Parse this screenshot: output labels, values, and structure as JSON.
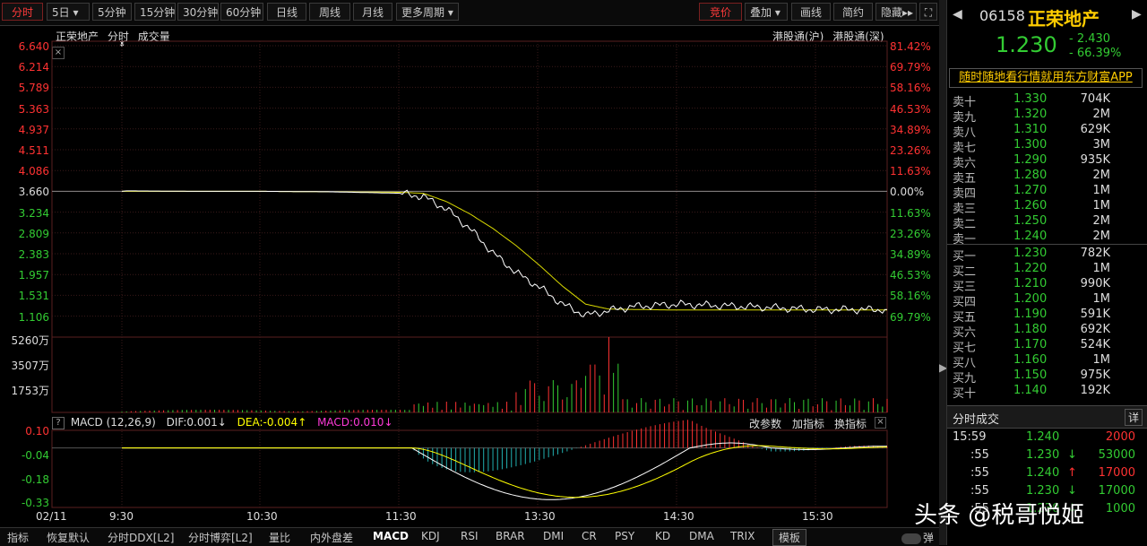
{
  "toolbar": {
    "tabs": [
      "分时",
      "5日",
      "5分钟",
      "15分钟",
      "30分钟",
      "60分钟",
      "日线",
      "周线",
      "月线",
      "更多周期"
    ],
    "right_buttons": [
      "竞价",
      "叠加",
      "画线",
      "简约",
      "隐藏"
    ]
  },
  "chart_header": {
    "name": "正荣地产",
    "mode": "分时",
    "volume_label": "成交量",
    "right_a": "港股通(沪)",
    "right_b": "港股通(深)"
  },
  "macd_header": {
    "label": "MACD (12,26,9)",
    "dif": "DIF:0.001↓",
    "dea": "DEA:-0.004↑",
    "macd": "MACD:0.010↓",
    "btn1": "改参数",
    "btn2": "加指标",
    "btn3": "换指标"
  },
  "colors": {
    "up": "#ff3232",
    "down": "#33cc33",
    "price_line": "#ffffff",
    "avg_line": "#d8d800",
    "grid": "#3a1a1a"
  },
  "chart_data": {
    "type": "line",
    "price_axis_left": [
      "6.640",
      "6.214",
      "5.789",
      "5.363",
      "4.937",
      "4.511",
      "4.086",
      "3.660",
      "3.234",
      "2.809",
      "2.383",
      "1.957",
      "1.531",
      "1.106"
    ],
    "pct_axis_right": [
      "81.42%",
      "69.79%",
      "58.16%",
      "46.53%",
      "34.89%",
      "23.26%",
      "11.63%",
      "0.00%",
      "11.63%",
      "23.26%",
      "34.89%",
      "46.53%",
      "58.16%",
      "69.79%"
    ],
    "volume_axis": [
      "5260万",
      "3507万",
      "1753万"
    ],
    "macd_axis": [
      "0.10",
      "-0.04",
      "-0.18",
      "-0.33"
    ],
    "time_labels": [
      "02/11",
      "9:30",
      "10:30",
      "11:30",
      "13:30",
      "14:30",
      "15:30"
    ],
    "price_series": [
      [
        0,
        3.66
      ],
      [
        2,
        3.67
      ],
      [
        30,
        3.66
      ],
      [
        60,
        3.66
      ],
      [
        90,
        3.65
      ],
      [
        120,
        3.62
      ],
      [
        130,
        3.55
      ],
      [
        140,
        3.3
      ],
      [
        150,
        2.9
      ],
      [
        160,
        2.4
      ],
      [
        170,
        2.0
      ],
      [
        180,
        1.7
      ],
      [
        190,
        1.35
      ],
      [
        200,
        1.12
      ],
      [
        210,
        1.22
      ],
      [
        220,
        1.3
      ],
      [
        240,
        1.35
      ],
      [
        270,
        1.3
      ],
      [
        300,
        1.24
      ],
      [
        330,
        1.24
      ]
    ],
    "avg_series": [
      [
        0,
        3.66
      ],
      [
        60,
        3.66
      ],
      [
        120,
        3.64
      ],
      [
        130,
        3.62
      ],
      [
        140,
        3.45
      ],
      [
        150,
        3.2
      ],
      [
        160,
        2.9
      ],
      [
        170,
        2.55
      ],
      [
        180,
        2.15
      ],
      [
        190,
        1.72
      ],
      [
        200,
        1.35
      ],
      [
        210,
        1.25
      ],
      [
        240,
        1.23
      ],
      [
        270,
        1.23
      ],
      [
        300,
        1.23
      ],
      [
        330,
        1.23
      ]
    ],
    "price_range": [
      1.106,
      6.64
    ],
    "macd_range": [
      -0.33,
      0.1
    ]
  },
  "quote": {
    "code": "06158",
    "name": "正荣地产",
    "price": "1.230",
    "change": "- 2.430",
    "change_pct": "- 66.39%",
    "ad": "随时随地看行情就用东方财富APP"
  },
  "order_book": {
    "sell": [
      {
        "label": "卖十",
        "price": "1.330",
        "vol": "704K"
      },
      {
        "label": "卖九",
        "price": "1.320",
        "vol": "2M"
      },
      {
        "label": "卖八",
        "price": "1.310",
        "vol": "629K"
      },
      {
        "label": "卖七",
        "price": "1.300",
        "vol": "3M"
      },
      {
        "label": "卖六",
        "price": "1.290",
        "vol": "935K"
      },
      {
        "label": "卖五",
        "price": "1.280",
        "vol": "2M"
      },
      {
        "label": "卖四",
        "price": "1.270",
        "vol": "1M"
      },
      {
        "label": "卖三",
        "price": "1.260",
        "vol": "1M"
      },
      {
        "label": "卖二",
        "price": "1.250",
        "vol": "2M"
      },
      {
        "label": "卖一",
        "price": "1.240",
        "vol": "2M"
      }
    ],
    "buy": [
      {
        "label": "买一",
        "price": "1.230",
        "vol": "782K"
      },
      {
        "label": "买二",
        "price": "1.220",
        "vol": "1M"
      },
      {
        "label": "买三",
        "price": "1.210",
        "vol": "990K"
      },
      {
        "label": "买四",
        "price": "1.200",
        "vol": "1M"
      },
      {
        "label": "买五",
        "price": "1.190",
        "vol": "591K"
      },
      {
        "label": "买六",
        "price": "1.180",
        "vol": "692K"
      },
      {
        "label": "买七",
        "price": "1.170",
        "vol": "524K"
      },
      {
        "label": "买八",
        "price": "1.160",
        "vol": "1M"
      },
      {
        "label": "买九",
        "price": "1.150",
        "vol": "975K"
      },
      {
        "label": "买十",
        "price": "1.140",
        "vol": "192K"
      }
    ]
  },
  "trades": {
    "title": "分时成交",
    "detail": "详",
    "rows": [
      {
        "time": "15:59",
        "price": "1.240",
        "arrow": "",
        "vol": "2000",
        "dir": "up"
      },
      {
        "time": ":55",
        "price": "1.230",
        "arrow": "↓",
        "vol": "53000",
        "dir": "down"
      },
      {
        "time": ":55",
        "price": "1.240",
        "arrow": "↑",
        "vol": "17000",
        "dir": "up"
      },
      {
        "time": ":55",
        "price": "1.230",
        "arrow": "↓",
        "vol": "17000",
        "dir": "down"
      },
      {
        "time": ":55",
        "price": "1.230",
        "arrow": "↓",
        "vol": "1000",
        "dir": "down"
      }
    ]
  },
  "bottom": {
    "items": [
      "指标",
      "恢复默认",
      "分时DDX[L2]",
      "分时博弈[L2]",
      "量比",
      "内外盘差",
      "MACD",
      "KDJ",
      "RSI",
      "BRAR",
      "DMI",
      "CR",
      "PSY",
      "KD",
      "DMA",
      "TRIX",
      "模板",
      "弹"
    ]
  },
  "watermark": "头条 @税哥悦姬"
}
